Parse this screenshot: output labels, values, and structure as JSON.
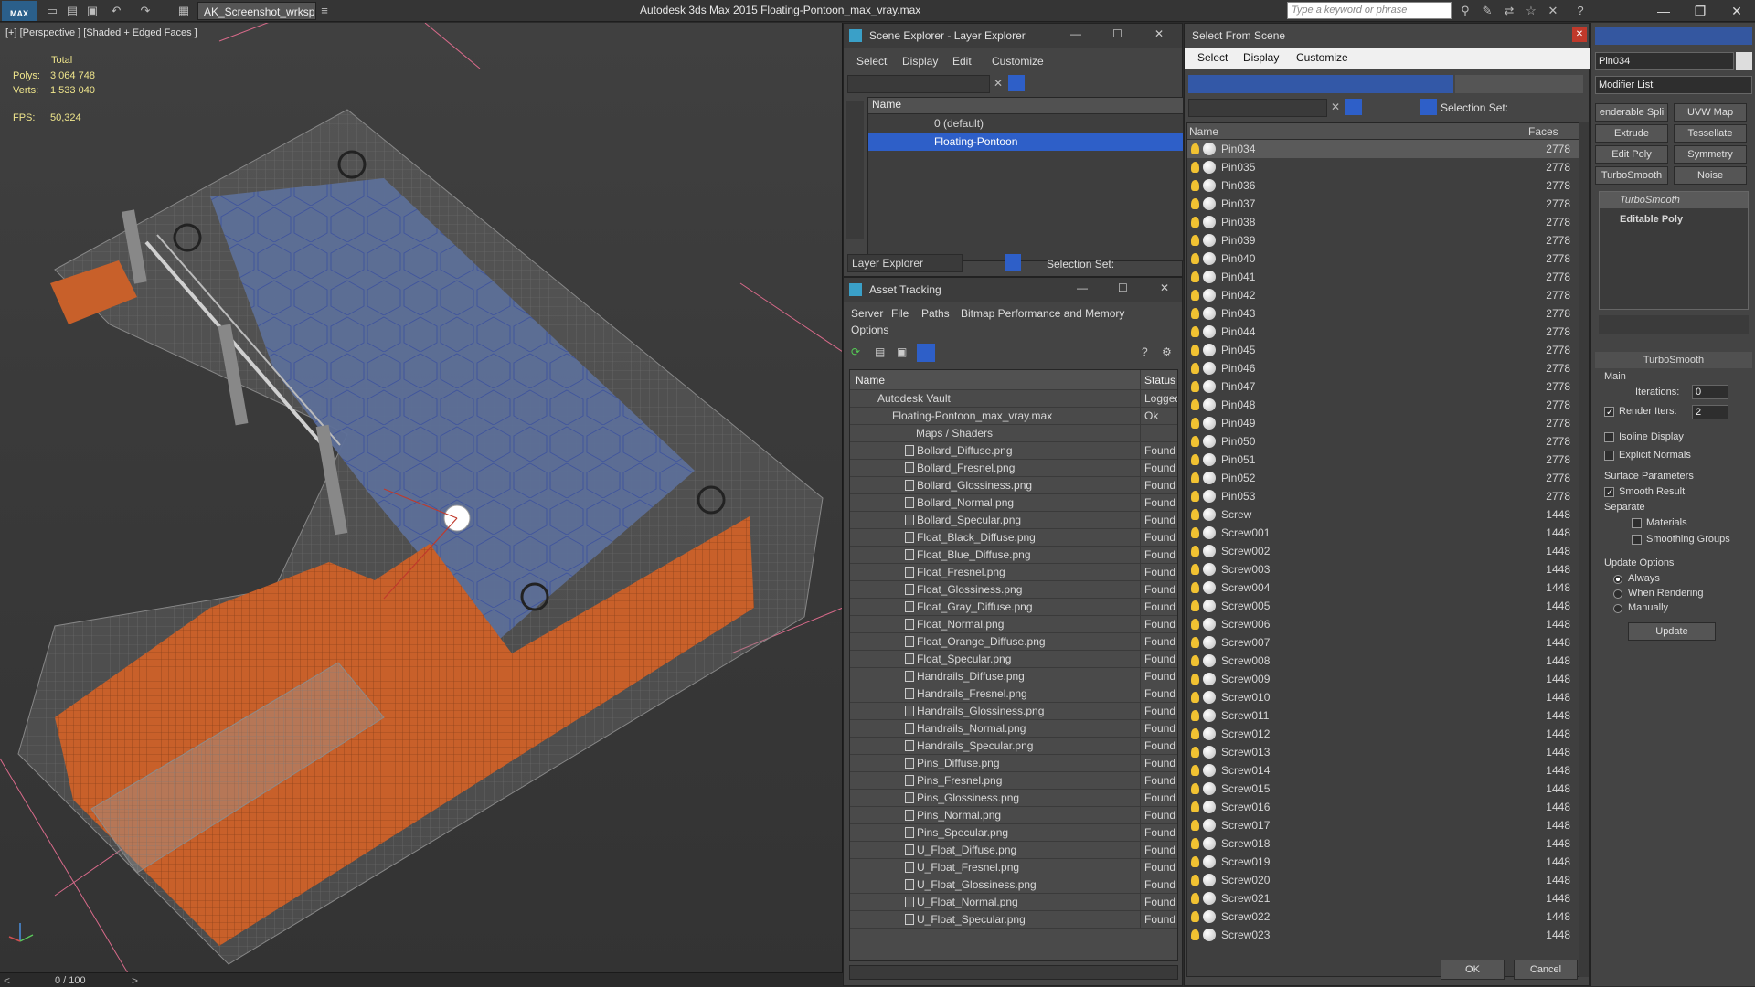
{
  "titlebar": {
    "logo": "MAX",
    "workspace": "AK_Screenshot_wrksp",
    "title": "Autodesk 3ds Max  2015     Floating-Pontoon_max_vray.max",
    "search_placeholder": "Type a keyword or phrase"
  },
  "viewport": {
    "label": "[+] [Perspective ] [Shaded + Edged Faces ]",
    "stats": {
      "total_label": "Total",
      "polys_label": "Polys:",
      "polys": "3 064 748",
      "verts_label": "Verts:",
      "verts": "1 533 040",
      "fps_label": "FPS:",
      "fps": "50,324"
    },
    "timeline": "0 / 100"
  },
  "scene_explorer": {
    "title": "Scene Explorer - Layer Explorer",
    "menu": [
      "Select",
      "Display",
      "Edit",
      "Customize"
    ],
    "column": "Name",
    "layers": [
      {
        "name": "0 (default)",
        "selected": false
      },
      {
        "name": "Floating-Pontoon",
        "selected": true
      }
    ],
    "mode": "Layer Explorer",
    "selection_set_label": "Selection Set:"
  },
  "asset_tracking": {
    "title": "Asset Tracking",
    "menu": [
      "Server",
      "File",
      "Paths",
      "Bitmap Performance and Memory"
    ],
    "menu2": "Options",
    "col_name": "Name",
    "col_status": "Status",
    "vault": {
      "name": "Autodesk Vault",
      "status": "Logged"
    },
    "file": {
      "name": "Floating-Pontoon_max_vray.max",
      "status": "Ok"
    },
    "folder": "Maps / Shaders",
    "maps": [
      {
        "name": "Bollard_Diffuse.png",
        "status": "Found"
      },
      {
        "name": "Bollard_Fresnel.png",
        "status": "Found"
      },
      {
        "name": "Bollard_Glossiness.png",
        "status": "Found"
      },
      {
        "name": "Bollard_Normal.png",
        "status": "Found"
      },
      {
        "name": "Bollard_Specular.png",
        "status": "Found"
      },
      {
        "name": "Float_Black_Diffuse.png",
        "status": "Found"
      },
      {
        "name": "Float_Blue_Diffuse.png",
        "status": "Found"
      },
      {
        "name": "Float_Fresnel.png",
        "status": "Found"
      },
      {
        "name": "Float_Glossiness.png",
        "status": "Found"
      },
      {
        "name": "Float_Gray_Diffuse.png",
        "status": "Found"
      },
      {
        "name": "Float_Normal.png",
        "status": "Found"
      },
      {
        "name": "Float_Orange_Diffuse.png",
        "status": "Found"
      },
      {
        "name": "Float_Specular.png",
        "status": "Found"
      },
      {
        "name": "Handrails_Diffuse.png",
        "status": "Found"
      },
      {
        "name": "Handrails_Fresnel.png",
        "status": "Found"
      },
      {
        "name": "Handrails_Glossiness.png",
        "status": "Found"
      },
      {
        "name": "Handrails_Normal.png",
        "status": "Found"
      },
      {
        "name": "Handrails_Specular.png",
        "status": "Found"
      },
      {
        "name": "Pins_Diffuse.png",
        "status": "Found"
      },
      {
        "name": "Pins_Fresnel.png",
        "status": "Found"
      },
      {
        "name": "Pins_Glossiness.png",
        "status": "Found"
      },
      {
        "name": "Pins_Normal.png",
        "status": "Found"
      },
      {
        "name": "Pins_Specular.png",
        "status": "Found"
      },
      {
        "name": "U_Float_Diffuse.png",
        "status": "Found"
      },
      {
        "name": "U_Float_Fresnel.png",
        "status": "Found"
      },
      {
        "name": "U_Float_Glossiness.png",
        "status": "Found"
      },
      {
        "name": "U_Float_Normal.png",
        "status": "Found"
      },
      {
        "name": "U_Float_Specular.png",
        "status": "Found"
      }
    ]
  },
  "select_from_scene": {
    "title": "Select From Scene",
    "menu": [
      "Select",
      "Display",
      "Customize"
    ],
    "selection_set_label": "Selection Set:",
    "col_name": "Name",
    "col_faces": "Faces",
    "objects": [
      {
        "name": "Pin034",
        "faces": "2778"
      },
      {
        "name": "Pin035",
        "faces": "2778"
      },
      {
        "name": "Pin036",
        "faces": "2778"
      },
      {
        "name": "Pin037",
        "faces": "2778"
      },
      {
        "name": "Pin038",
        "faces": "2778"
      },
      {
        "name": "Pin039",
        "faces": "2778"
      },
      {
        "name": "Pin040",
        "faces": "2778"
      },
      {
        "name": "Pin041",
        "faces": "2778"
      },
      {
        "name": "Pin042",
        "faces": "2778"
      },
      {
        "name": "Pin043",
        "faces": "2778"
      },
      {
        "name": "Pin044",
        "faces": "2778"
      },
      {
        "name": "Pin045",
        "faces": "2778"
      },
      {
        "name": "Pin046",
        "faces": "2778"
      },
      {
        "name": "Pin047",
        "faces": "2778"
      },
      {
        "name": "Pin048",
        "faces": "2778"
      },
      {
        "name": "Pin049",
        "faces": "2778"
      },
      {
        "name": "Pin050",
        "faces": "2778"
      },
      {
        "name": "Pin051",
        "faces": "2778"
      },
      {
        "name": "Pin052",
        "faces": "2778"
      },
      {
        "name": "Pin053",
        "faces": "2778"
      },
      {
        "name": "Screw",
        "faces": "1448"
      },
      {
        "name": "Screw001",
        "faces": "1448"
      },
      {
        "name": "Screw002",
        "faces": "1448"
      },
      {
        "name": "Screw003",
        "faces": "1448"
      },
      {
        "name": "Screw004",
        "faces": "1448"
      },
      {
        "name": "Screw005",
        "faces": "1448"
      },
      {
        "name": "Screw006",
        "faces": "1448"
      },
      {
        "name": "Screw007",
        "faces": "1448"
      },
      {
        "name": "Screw008",
        "faces": "1448"
      },
      {
        "name": "Screw009",
        "faces": "1448"
      },
      {
        "name": "Screw010",
        "faces": "1448"
      },
      {
        "name": "Screw011",
        "faces": "1448"
      },
      {
        "name": "Screw012",
        "faces": "1448"
      },
      {
        "name": "Screw013",
        "faces": "1448"
      },
      {
        "name": "Screw014",
        "faces": "1448"
      },
      {
        "name": "Screw015",
        "faces": "1448"
      },
      {
        "name": "Screw016",
        "faces": "1448"
      },
      {
        "name": "Screw017",
        "faces": "1448"
      },
      {
        "name": "Screw018",
        "faces": "1448"
      },
      {
        "name": "Screw019",
        "faces": "1448"
      },
      {
        "name": "Screw020",
        "faces": "1448"
      },
      {
        "name": "Screw021",
        "faces": "1448"
      },
      {
        "name": "Screw022",
        "faces": "1448"
      },
      {
        "name": "Screw023",
        "faces": "1448"
      }
    ],
    "ok_label": "OK",
    "cancel_label": "Cancel"
  },
  "command_panel": {
    "object_name": "Pin034",
    "modifier_list": "Modifier List",
    "buttons": [
      "enderable Spli",
      "UVW Map",
      "Extrude",
      "Tessellate",
      "Edit Poly",
      "Symmetry",
      "TurboSmooth",
      "Noise"
    ],
    "stack": [
      "TurboSmooth",
      "Editable Poly"
    ],
    "rollout": "TurboSmooth",
    "main_label": "Main",
    "iterations_label": "Iterations:",
    "iterations": "0",
    "render_iters_label": "Render Iters:",
    "render_iters": "2",
    "isoline": "Isoline Display",
    "explicit_normals": "Explicit Normals",
    "surface_params": "Surface Parameters",
    "smooth_result": "Smooth Result",
    "separate": "Separate",
    "materials": "Materials",
    "smoothing_groups": "Smoothing Groups",
    "update_options": "Update Options",
    "always": "Always",
    "when_rendering": "When Rendering",
    "manually": "Manually",
    "update_label": "Update"
  },
  "colors": {
    "selection_blue": "#2e5fc8",
    "float_orange": "#c8602a",
    "deck_blue": "#5a6f9a"
  }
}
